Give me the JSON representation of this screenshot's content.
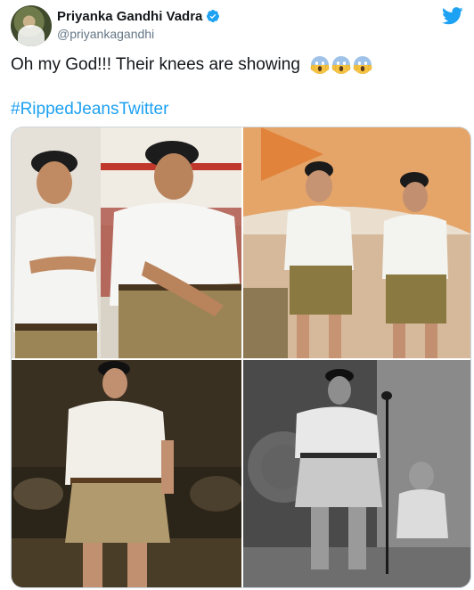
{
  "author": {
    "display_name": "Priyanka Gandhi Vadra",
    "handle": "@priyankagandhi",
    "verified": true,
    "avatar_icon": "profile-avatar"
  },
  "platform_icon": "twitter-bird-icon",
  "colors": {
    "accent": "#1da1f2",
    "text": "#14171a",
    "muted": "#657786",
    "border": "#ccd6dd"
  },
  "tweet": {
    "text": "Oh my God!!! Their knees are showing",
    "emojis": [
      "face-screaming-in-fear",
      "face-screaming-in-fear",
      "face-screaming-in-fear"
    ],
    "hashtag": "#RippedJeansTwitter"
  },
  "media": {
    "photo_count": 4,
    "photos": [
      "photo-top-left",
      "photo-top-right",
      "photo-bottom-left",
      "photo-bottom-right"
    ]
  }
}
